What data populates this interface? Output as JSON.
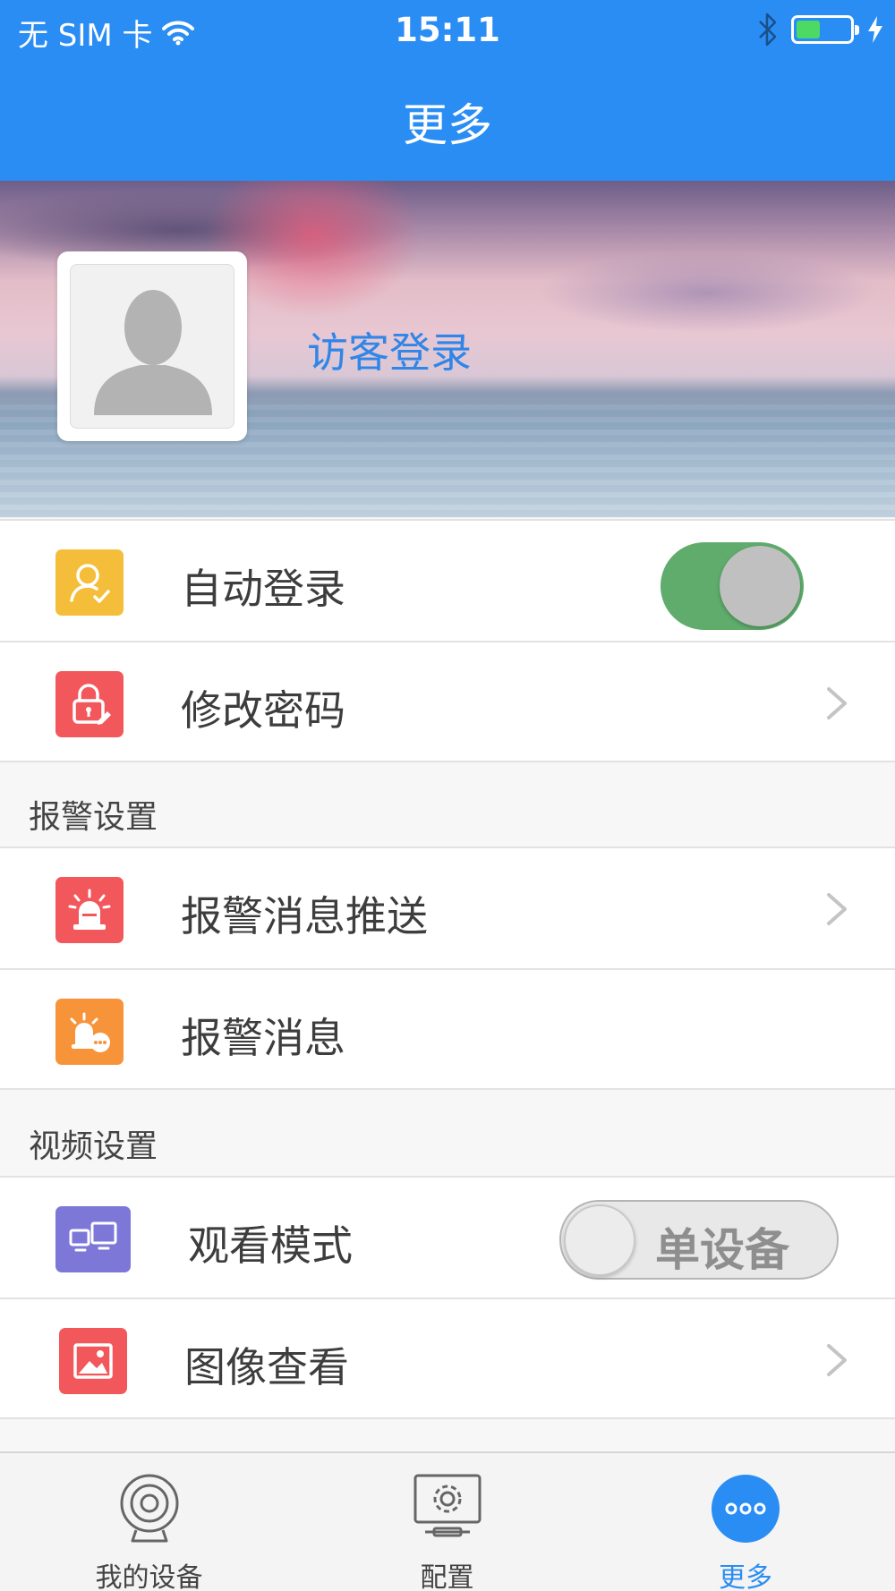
{
  "status_bar": {
    "carrier": "无 SIM 卡",
    "time": "15:11",
    "battery_level": 0.45
  },
  "nav": {
    "title": "更多"
  },
  "profile": {
    "guest_login": "访客登录"
  },
  "account_rows": {
    "auto_login": {
      "label": "自动登录",
      "toggle_on": true
    },
    "change_password": {
      "label": "修改密码"
    }
  },
  "alarm_section": {
    "header": "报警设置",
    "push": {
      "label": "报警消息推送"
    },
    "messages": {
      "label": "报警消息"
    }
  },
  "video_section": {
    "header": "视频设置",
    "view_mode": {
      "label": "观看模式",
      "value": "单设备"
    },
    "image_view": {
      "label": "图像查看"
    }
  },
  "tabbar": {
    "tabs": [
      {
        "label": "我的设备",
        "icon": "camera-icon",
        "active": false
      },
      {
        "label": "配置",
        "icon": "settings-monitor-icon",
        "active": false
      },
      {
        "label": "更多",
        "icon": "more-dots-icon",
        "active": true
      }
    ]
  },
  "colors": {
    "primary": "#2a8df4",
    "toggle_on": "#5fac6c",
    "icon_yellow": "#f4be3a",
    "icon_red": "#f2575c",
    "icon_orange": "#f7943a",
    "icon_purple": "#7d78d8"
  }
}
